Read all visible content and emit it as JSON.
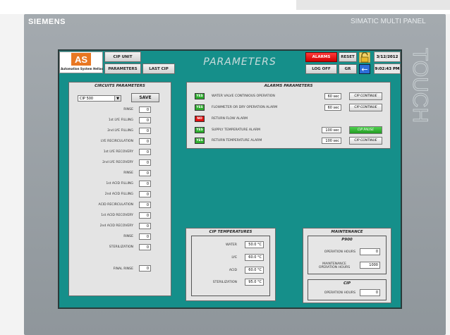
{
  "device": {
    "brand": "SIEMENS",
    "model": "SIMATIC MULTI PANEL",
    "side_label": "TOUCH"
  },
  "header": {
    "logo_text": "AS",
    "logo_subtitle": "Automation System Hellas",
    "cip_unit_label": "CIP UNIT",
    "parameters_label": "PARAMETERS",
    "last_cip_label": "LAST CIP",
    "title": "PARAMETERS",
    "alarms_label": "ALARMS",
    "reset_label": "RESET",
    "logoff_label": "LOG OFF",
    "gr_label": "GR",
    "date": "3/12/2012",
    "time": "9:02:43 PM"
  },
  "circuits": {
    "title": "CIRCUITS PARAMETERS",
    "selected": "CIP 500",
    "save_label": "SAVE",
    "rows": [
      {
        "label": "RINSE",
        "value": "0"
      },
      {
        "label": "1st LYE FILLING",
        "value": "0"
      },
      {
        "label": "2nd LYE FILLING",
        "value": "0"
      },
      {
        "label": "LYE RECIRCULATION",
        "value": "0"
      },
      {
        "label": "1st LYE RECOVERY",
        "value": "0"
      },
      {
        "label": "2nd LYE RECOVERY",
        "value": "0"
      },
      {
        "label": "RINSE",
        "value": "0"
      },
      {
        "label": "1st ACID FILLING",
        "value": "0"
      },
      {
        "label": "2nd ACID FILLING",
        "value": "0"
      },
      {
        "label": "ACID RECIRCULATION",
        "value": "0"
      },
      {
        "label": "1st ACID RECOVERY",
        "value": "0"
      },
      {
        "label": "2nd ACID RECOVERY",
        "value": "0"
      },
      {
        "label": "RINSE",
        "value": "0"
      },
      {
        "label": "STERILIZATION",
        "value": "0"
      }
    ],
    "final_rinse_label": "FINAL RINSE",
    "final_rinse_value": "0"
  },
  "alarms": {
    "title": "ALARMS PARAMETERS",
    "rows": [
      {
        "status": "YES",
        "label": "WATER VALVE CONTINIOUS OPERATION",
        "time": "60 sec",
        "action": "CIP CONTINUE"
      },
      {
        "status": "YES",
        "label": "FLOWMETER OR DRY OPERATION ALARM",
        "time": "60 sec",
        "action": "CIP CONTINUE"
      },
      {
        "status": "NO",
        "label": "RETURN FLOW ALARM",
        "time": "",
        "action": ""
      },
      {
        "status": "YES",
        "label": "SUPPLY TEMPERATURE ALARM",
        "time": "100 sec",
        "action": "CIP PAUSE"
      },
      {
        "status": "YES",
        "label": "RETURN TEMPERATURE ALARM",
        "time": "100 sec",
        "action": "CIP CONTINUE"
      }
    ]
  },
  "temperatures": {
    "title": "CIP TEMPERATURES",
    "rows": [
      {
        "label": "WATER",
        "value": "50.0 °C"
      },
      {
        "label": "LYE",
        "value": "60.0 °C"
      },
      {
        "label": "ACID",
        "value": "60.0 °C"
      },
      {
        "label": "STERILIZATION",
        "value": "95.0 °C"
      }
    ]
  },
  "maintenance": {
    "title": "MAINTENANCE",
    "p900_title": "P900",
    "operation_hours_label": "OPERATION HOURS",
    "operation_hours_value": "0",
    "maintenance_hours_label": "MAINTENANCE OPERATION HOURS",
    "maintenance_hours_value": "1000",
    "cip_title": "CIP",
    "cip_operation_hours_label": "OPERATION HOURS",
    "cip_operation_hours_value": "0"
  },
  "colors": {
    "screen": "#158f8a",
    "yes": "#2fae2f",
    "no": "#e01010",
    "alarm_button": "#e01010",
    "logo": "#e87722"
  }
}
